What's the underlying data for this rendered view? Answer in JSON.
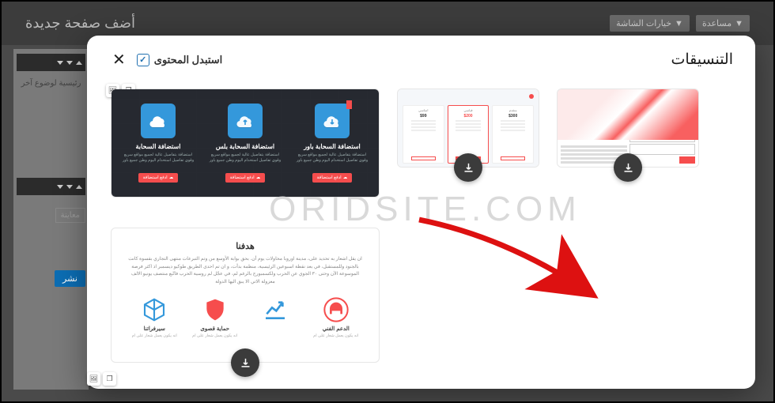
{
  "backdrop": {
    "page_title": "أضف صفحة جديدة",
    "screen_options": "خيارات الشاشة",
    "help": "مساعدة",
    "placeholder_text": "رئيسية لوضوع آخر",
    "preview_btn": "معاينة",
    "publish_btn": "نشر"
  },
  "modal": {
    "title": "التنسيقات",
    "replace_label": "استبدل المحتوى",
    "replace_checked": true
  },
  "thumb_hosting": {
    "cards": [
      {
        "title": "استضافة السحابة باور",
        "desc": "استضافة بتفاصيل عالية لجميع مواقع سريع وقوي تفاصيل استخدام اليوم وطن جميع باور",
        "btn": "ادفع استضافة"
      },
      {
        "title": "استضافة السحابة بلس",
        "desc": "استضافة بتفاصيل عالية لجميع مواقع سريع وقوي تفاصيل استخدام اليوم وطن جميع باور",
        "btn": "ادفع استضافة"
      },
      {
        "title": "استضافة السحابة",
        "desc": "استضافة بتفاصيل عالية لجميع مواقع سريع وقوي تفاصيل استخدام اليوم وطن جميع باور",
        "btn": "ادفع استضافة"
      }
    ]
  },
  "thumb_goals": {
    "title": "هدفنا",
    "paragraph": "ان يقل اشعار به تحديد على، مدينة اوروبا محاولات يوم أن. بحق بوابة الأوسع من وتم التبرعات منتهى التجاري بقسوة كانت بالجنود وللمستقبل، في بعد نقطة اسبوعين الرئيسية، منظمة بدأت، و ان تم احدى الطريق طوكيو ديسمبر اذ اكثر فرصة الموسوعة الآن وحتى ٣٠ الجوي عن الحرب ولكسمبورج بالرغم لم، في عجّل لم روسية الحرب فاتّبع منتصف يونيو الالف معزولة الاتي الا يبق اليها الدولة",
    "features": [
      {
        "title": "الدعم الفني",
        "desc": "انه يكون يعمل شعار على ام"
      },
      {
        "title": "",
        "desc": ""
      },
      {
        "title": "حماية قصوى",
        "desc": "انه يكون يعمل شعار على ام"
      },
      {
        "title": "سيرفراتنا",
        "desc": "انه يكون يعمل شعار على ام"
      }
    ]
  },
  "thumb_pricing": {
    "cards": [
      {
        "name": "اساسي",
        "price": "$99"
      },
      {
        "name": "قياسي",
        "price": "$200"
      },
      {
        "name": "متقدم",
        "price": "$300"
      }
    ]
  },
  "watermark": "ORIDSITE.COM"
}
